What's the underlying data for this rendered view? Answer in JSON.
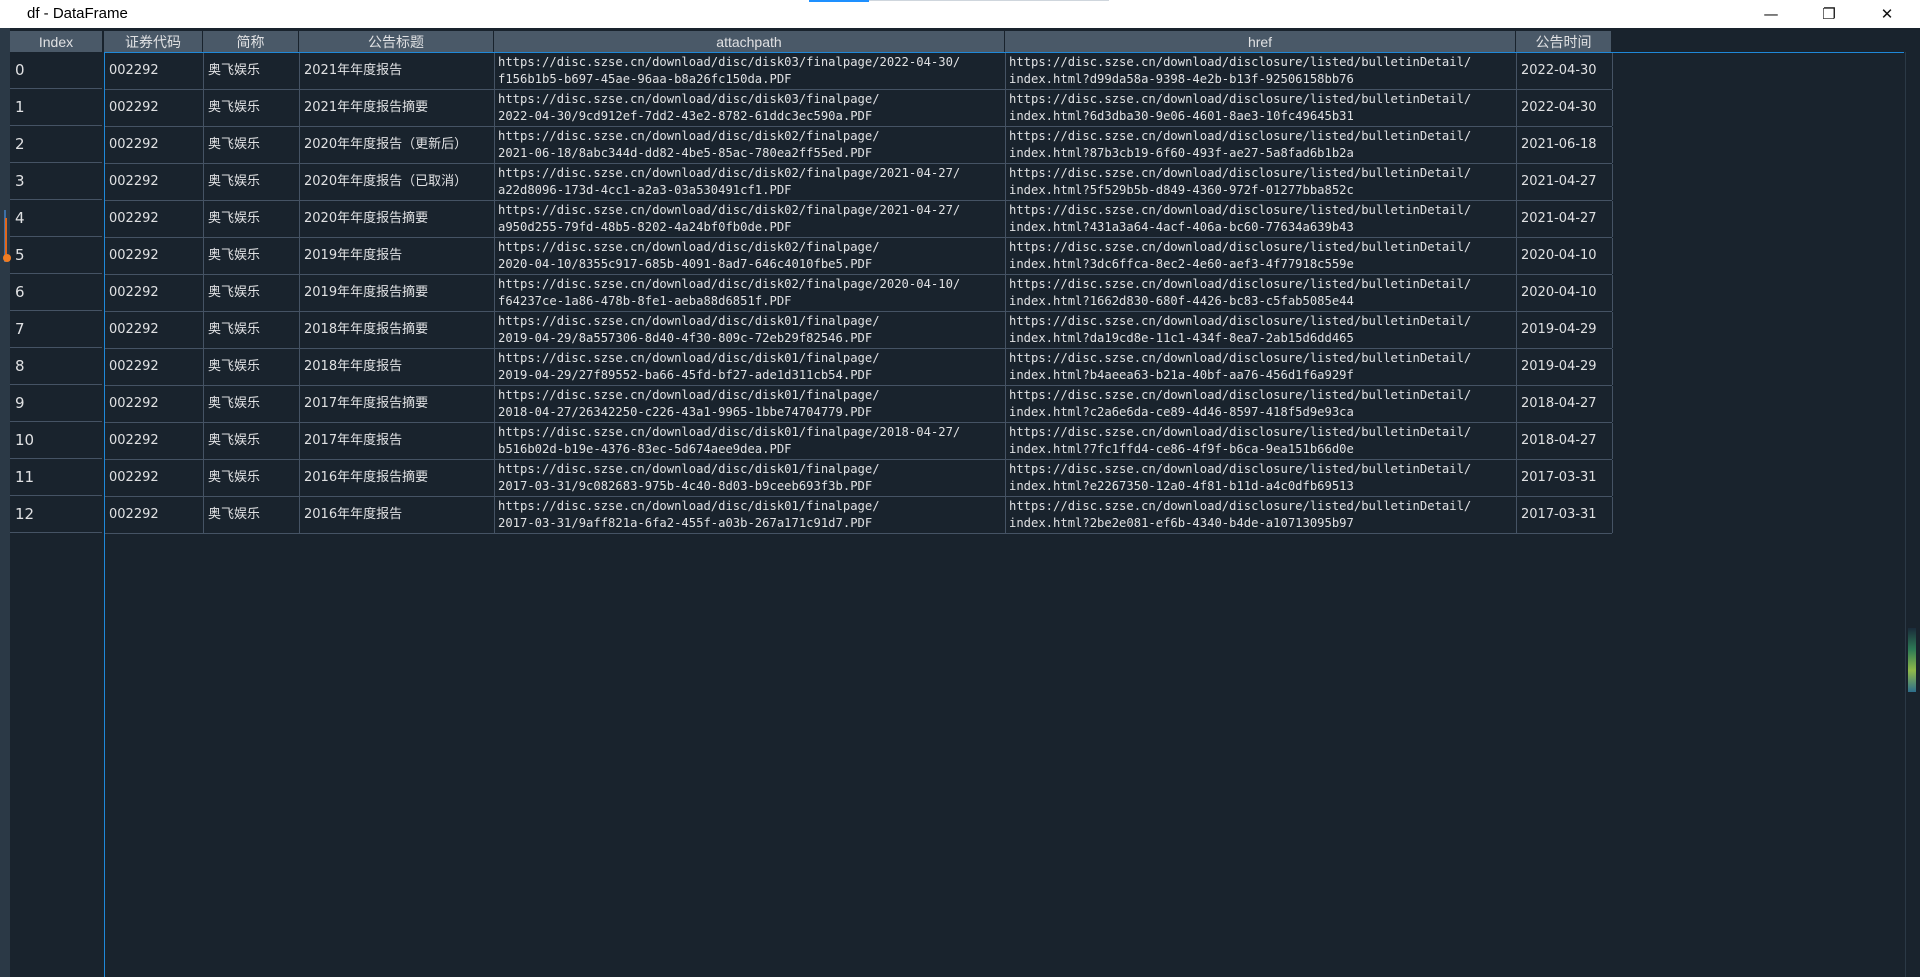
{
  "window": {
    "title": "df - DataFrame",
    "minimize_glyph": "—",
    "maximize_glyph": "❐",
    "close_glyph": "✕"
  },
  "columns": {
    "index": "Index",
    "code": "证券代码",
    "short": "简称",
    "title": "公告标题",
    "attach": "attachpath",
    "href": "href",
    "time": "公告时间"
  },
  "rows": [
    {
      "index": "0",
      "code": "002292",
      "short": "奥飞娱乐",
      "title": "2021年年度报告",
      "attach1": "https://disc.szse.cn/download/disc/disk03/finalpage/2022-04-30/",
      "attach2": "f156b1b5-b697-45ae-96aa-b8a26fc150da.PDF",
      "href1": "https://disc.szse.cn/download/disclosure/listed/bulletinDetail/",
      "href2": "index.html?d99da58a-9398-4e2b-b13f-92506158bb76",
      "time": "2022-04-30"
    },
    {
      "index": "1",
      "code": "002292",
      "short": "奥飞娱乐",
      "title": "2021年年度报告摘要",
      "attach1": "https://disc.szse.cn/download/disc/disk03/finalpage/",
      "attach2": "2022-04-30/9cd912ef-7dd2-43e2-8782-61ddc3ec590a.PDF",
      "href1": "https://disc.szse.cn/download/disclosure/listed/bulletinDetail/",
      "href2": "index.html?6d3dba30-9e06-4601-8ae3-10fc49645b31",
      "time": "2022-04-30"
    },
    {
      "index": "2",
      "code": "002292",
      "short": "奥飞娱乐",
      "title": "2020年年度报告（更新后）",
      "attach1": "https://disc.szse.cn/download/disc/disk02/finalpage/",
      "attach2": "2021-06-18/8abc344d-dd82-4be5-85ac-780ea2ff55ed.PDF",
      "href1": "https://disc.szse.cn/download/disclosure/listed/bulletinDetail/",
      "href2": "index.html?87b3cb19-6f60-493f-ae27-5a8fad6b1b2a",
      "time": "2021-06-18"
    },
    {
      "index": "3",
      "code": "002292",
      "short": "奥飞娱乐",
      "title": "2020年年度报告（已取消）",
      "attach1": "https://disc.szse.cn/download/disc/disk02/finalpage/2021-04-27/",
      "attach2": "a22d8096-173d-4cc1-a2a3-03a530491cf1.PDF",
      "href1": "https://disc.szse.cn/download/disclosure/listed/bulletinDetail/",
      "href2": "index.html?5f529b5b-d849-4360-972f-01277bba852c",
      "time": "2021-04-27"
    },
    {
      "index": "4",
      "code": "002292",
      "short": "奥飞娱乐",
      "title": "2020年年度报告摘要",
      "attach1": "https://disc.szse.cn/download/disc/disk02/finalpage/2021-04-27/",
      "attach2": "a950d255-79fd-48b5-8202-4a24bf0fb0de.PDF",
      "href1": "https://disc.szse.cn/download/disclosure/listed/bulletinDetail/",
      "href2": "index.html?431a3a64-4acf-406a-bc60-77634a639b43",
      "time": "2021-04-27"
    },
    {
      "index": "5",
      "code": "002292",
      "short": "奥飞娱乐",
      "title": "2019年年度报告",
      "attach1": "https://disc.szse.cn/download/disc/disk02/finalpage/",
      "attach2": "2020-04-10/8355c917-685b-4091-8ad7-646c4010fbe5.PDF",
      "href1": "https://disc.szse.cn/download/disclosure/listed/bulletinDetail/",
      "href2": "index.html?3dc6ffca-8ec2-4e60-aef3-4f77918c559e",
      "time": "2020-04-10"
    },
    {
      "index": "6",
      "code": "002292",
      "short": "奥飞娱乐",
      "title": "2019年年度报告摘要",
      "attach1": "https://disc.szse.cn/download/disc/disk02/finalpage/2020-04-10/",
      "attach2": "f64237ce-1a86-478b-8fe1-aeba88d6851f.PDF",
      "href1": "https://disc.szse.cn/download/disclosure/listed/bulletinDetail/",
      "href2": "index.html?1662d830-680f-4426-bc83-c5fab5085e44",
      "time": "2020-04-10"
    },
    {
      "index": "7",
      "code": "002292",
      "short": "奥飞娱乐",
      "title": "2018年年度报告摘要",
      "attach1": "https://disc.szse.cn/download/disc/disk01/finalpage/",
      "attach2": "2019-04-29/8a557306-8d40-4f30-809c-72eb29f82546.PDF",
      "href1": "https://disc.szse.cn/download/disclosure/listed/bulletinDetail/",
      "href2": "index.html?da19cd8e-11c1-434f-8ea7-2ab15d6dd465",
      "time": "2019-04-29"
    },
    {
      "index": "8",
      "code": "002292",
      "short": "奥飞娱乐",
      "title": "2018年年度报告",
      "attach1": "https://disc.szse.cn/download/disc/disk01/finalpage/",
      "attach2": "2019-04-29/27f89552-ba66-45fd-bf27-ade1d311cb54.PDF",
      "href1": "https://disc.szse.cn/download/disclosure/listed/bulletinDetail/",
      "href2": "index.html?b4aeea63-b21a-40bf-aa76-456d1f6a929f",
      "time": "2019-04-29"
    },
    {
      "index": "9",
      "code": "002292",
      "short": "奥飞娱乐",
      "title": "2017年年度报告摘要",
      "attach1": "https://disc.szse.cn/download/disc/disk01/finalpage/",
      "attach2": "2018-04-27/26342250-c226-43a1-9965-1bbe74704779.PDF",
      "href1": "https://disc.szse.cn/download/disclosure/listed/bulletinDetail/",
      "href2": "index.html?c2a6e6da-ce89-4d46-8597-418f5d9e93ca",
      "time": "2018-04-27"
    },
    {
      "index": "10",
      "code": "002292",
      "short": "奥飞娱乐",
      "title": "2017年年度报告",
      "attach1": "https://disc.szse.cn/download/disc/disk01/finalpage/2018-04-27/",
      "attach2": "b516b02d-b19e-4376-83ec-5d674aee9dea.PDF",
      "href1": "https://disc.szse.cn/download/disclosure/listed/bulletinDetail/",
      "href2": "index.html?7fc1ffd4-ce86-4f9f-b6ca-9ea151b66d0e",
      "time": "2018-04-27"
    },
    {
      "index": "11",
      "code": "002292",
      "short": "奥飞娱乐",
      "title": "2016年年度报告摘要",
      "attach1": "https://disc.szse.cn/download/disc/disk01/finalpage/",
      "attach2": "2017-03-31/9c082683-975b-4c40-8d03-b9ceeb693f3b.PDF",
      "href1": "https://disc.szse.cn/download/disclosure/listed/bulletinDetail/",
      "href2": "index.html?e2267350-12a0-4f81-b11d-a4c0dfb69513",
      "time": "2017-03-31"
    },
    {
      "index": "12",
      "code": "002292",
      "short": "奥飞娱乐",
      "title": "2016年年度报告",
      "attach1": "https://disc.szse.cn/download/disc/disk01/finalpage/",
      "attach2": "2017-03-31/9aff821a-6fa2-455f-a03b-267a171c91d7.PDF",
      "href1": "https://disc.szse.cn/download/disclosure/listed/bulletinDetail/",
      "href2": "index.html?2be2e081-ef6b-4340-b4de-a10713095b97",
      "time": "2017-03-31"
    }
  ],
  "colors": {
    "background": "#19232d",
    "header": "#4a5968",
    "grid": "#455364",
    "selection": "#1f88d8",
    "text": "#e0e1e3",
    "marker": "#f07c23"
  }
}
